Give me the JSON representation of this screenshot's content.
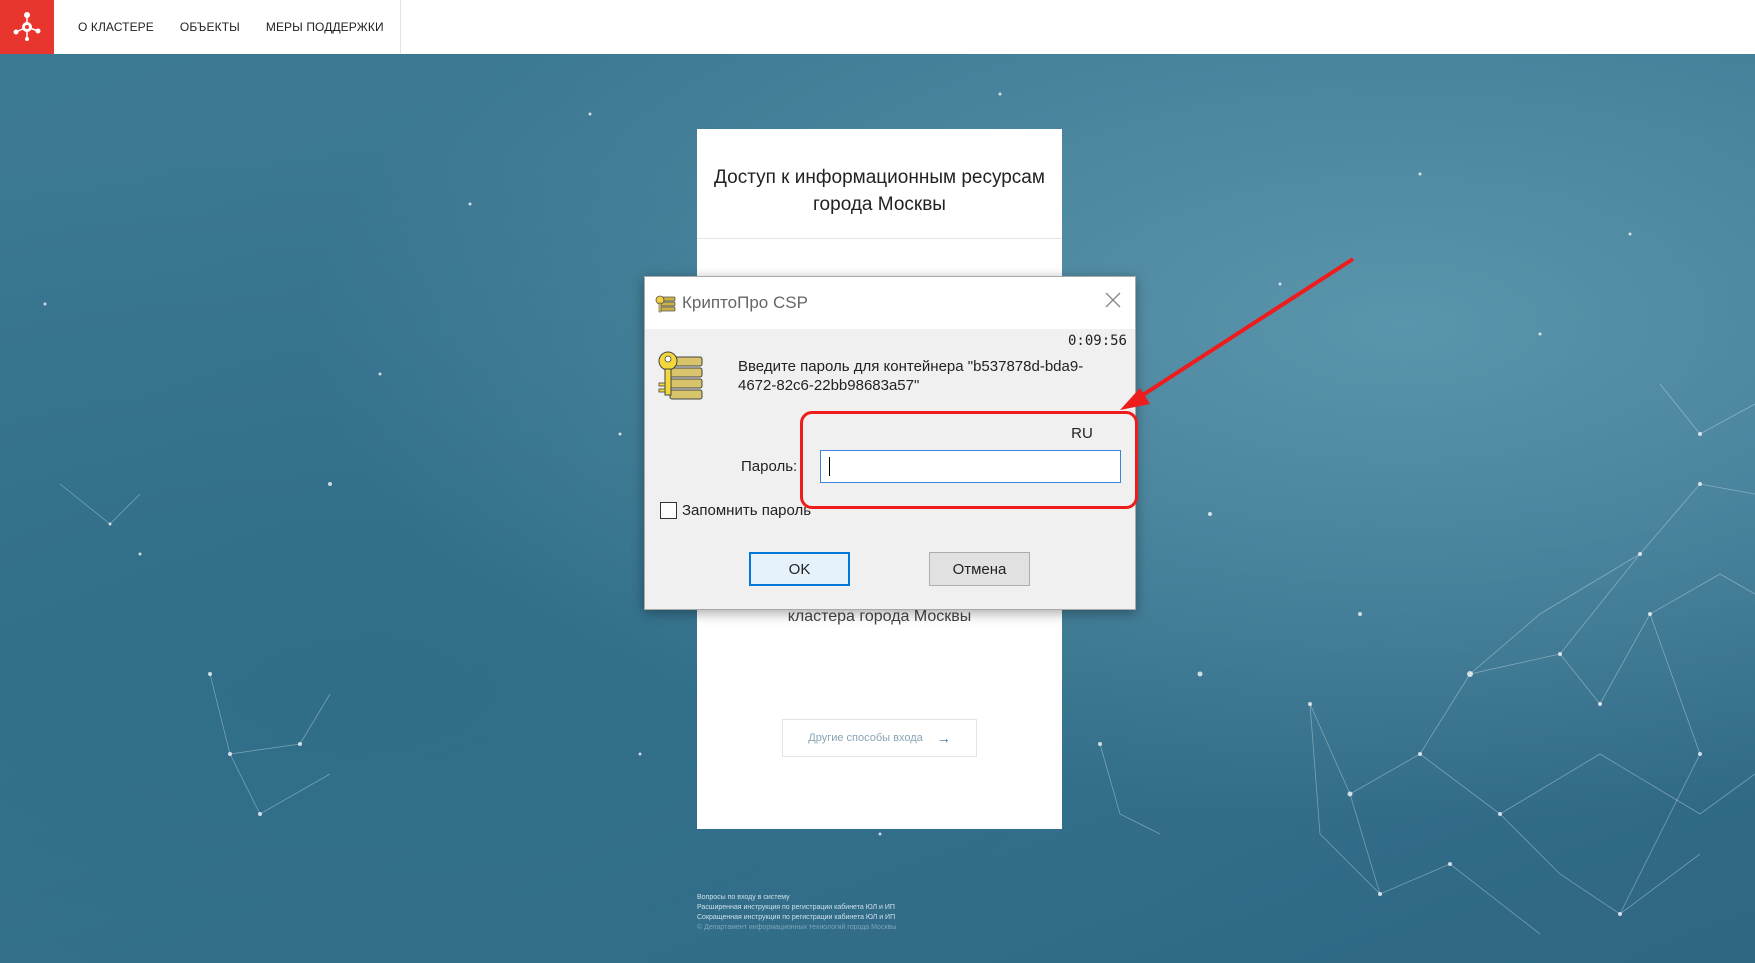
{
  "nav": {
    "items": [
      "О КЛАСТЕРЕ",
      "ОБЪЕКТЫ",
      "МЕРЫ ПОДДЕРЖКИ"
    ]
  },
  "card": {
    "title_line1": "Доступ к информационным ресурсам",
    "title_line2": "города Москвы",
    "subtitle": "кластера города Москвы",
    "other_methods": "Другие способы входа",
    "other_methods_arrow": "→"
  },
  "footer": {
    "lines": [
      "Вопросы по входу в систему",
      "Расширенная инструкция по регистрации кабинета ЮЛ и ИП",
      "Сокращенная инструкция по регистрации кабинета ЮЛ и ИП"
    ],
    "copyright": "© Департамент информационных технологий города Москвы"
  },
  "dialog": {
    "title": "КриптоПро CSP",
    "close_glyph": "╳",
    "timer": "0:09:56",
    "prompt_line1": "Введите пароль для контейнера \"b537878d-bda9-",
    "prompt_line2": "4672-82c6-22bb98683a57\"",
    "lang": "RU",
    "password_label": "Пароль:",
    "password_value": "",
    "remember_label": "Запомнить пароль",
    "ok_label": "OK",
    "cancel_label": "Отмена"
  },
  "colors": {
    "brand_red": "#e8352e",
    "annotation_red": "#ee1c1c",
    "background_teal": "#3a7590",
    "focus_blue": "#0078d7"
  }
}
